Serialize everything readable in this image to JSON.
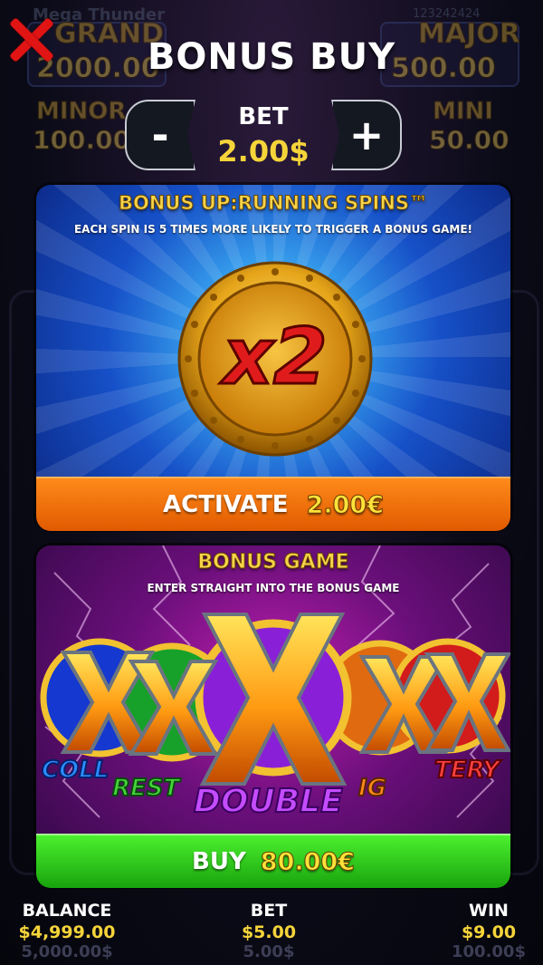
{
  "background": {
    "game_title": "Mega Thunder",
    "game_id": "123242424",
    "jackpots": [
      {
        "label": "GRAND",
        "value": "2000.00"
      },
      {
        "label": "MAJOR",
        "value": "500.00"
      },
      {
        "label": "MINOR",
        "value": "100.00"
      },
      {
        "label": "MINI",
        "value": "50.00"
      }
    ]
  },
  "header": {
    "title": "BONUS BUY",
    "close_icon": "close-icon"
  },
  "bet_selector": {
    "minus_label": "-",
    "plus_label": "+",
    "label": "BET",
    "value": "2.00$"
  },
  "offers": [
    {
      "title": "BONUS UP:RUNNING SPINS™",
      "description": "EACH SPIN IS 5 TIMES MORE LIKELY TO TRIGGER A BONUS GAME!",
      "badge": "x2",
      "button_label": "ACTIVATE",
      "button_price": "2.00€",
      "accent": "#ff7a0f"
    },
    {
      "title": "BONUS GAME",
      "description": "ENTER STRAIGHT INTO THE BONUS GAME",
      "symbol_labels": [
        "COLL",
        "REST",
        "DOUBLE",
        "IG",
        "TERY"
      ],
      "button_label": "BUY",
      "button_price": "80.00€",
      "accent": "#2ecc1a"
    }
  ],
  "footer": {
    "balance_label": "BALANCE",
    "balance_value": "$4,999.00",
    "balance_ghost": "5,000.00$",
    "bet_label": "BET",
    "bet_value": "$5.00",
    "bet_ghost": "5.00$",
    "win_label": "WIN",
    "win_value": "$9.00",
    "win_ghost": "100.00$"
  }
}
